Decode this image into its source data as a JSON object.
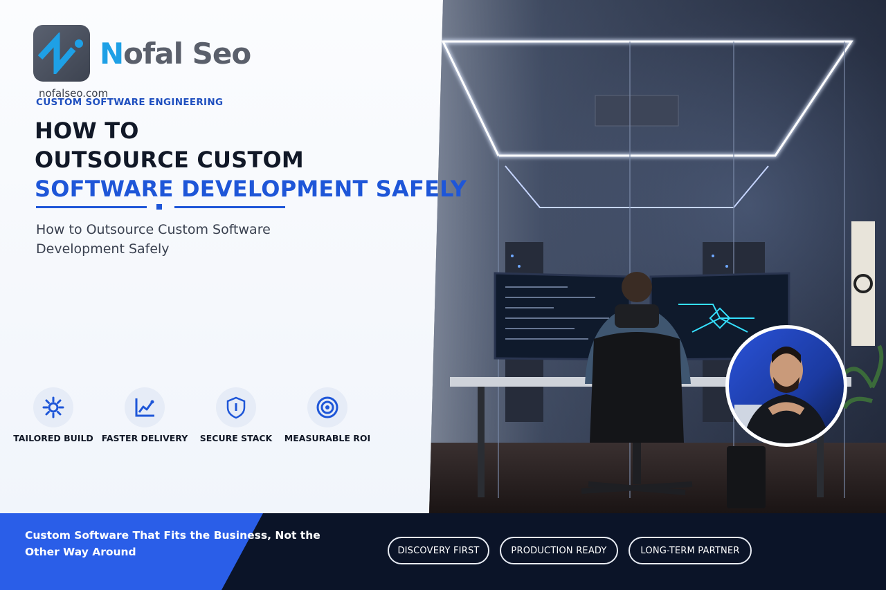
{
  "brand": {
    "name_first": "N",
    "name_rest": "ofal Seo",
    "site": "nofalseo.com"
  },
  "hero": {
    "eyebrow": "CUSTOM SOFTWARE ENGINEERING",
    "title_line1": "HOW TO",
    "title_line2": "OUTSOURCE CUSTOM",
    "title_line3": "SOFTWARE DEVELOPMENT SAFELY",
    "subtitle": "How to Outsource Custom Software Development Safely"
  },
  "features": [
    {
      "label": "TAILORED BUILD",
      "icon": "gear-icon"
    },
    {
      "label": "FASTER DELIVERY",
      "icon": "trend-chart-icon"
    },
    {
      "label": "SECURE STACK",
      "icon": "shield-icon"
    },
    {
      "label": "MEASURABLE ROI",
      "icon": "target-icon"
    }
  ],
  "footer": {
    "tagline": "Custom Software That Fits the Business, Not the Other Way Around",
    "pills": [
      "DISCOVERY FIRST",
      "PRODUCTION READY",
      "LONG-TERM PARTNER"
    ]
  },
  "colors": {
    "accent": "#1e56d8",
    "logo_n": "#1ea0e6",
    "footer_bg": "#0b1428",
    "footer_blue": "#2a5ee8"
  }
}
